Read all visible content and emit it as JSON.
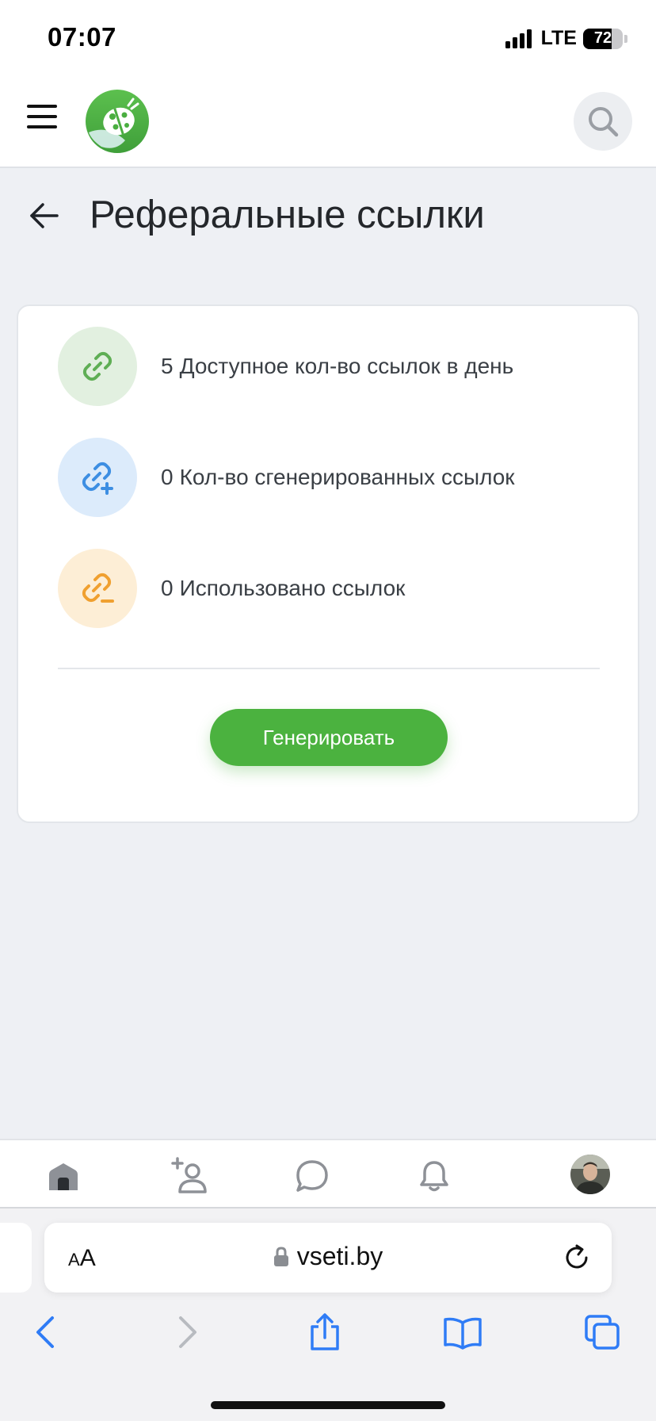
{
  "status_bar": {
    "time": "07:07",
    "network": "LTE",
    "battery": "72",
    "battery_level": 0.72
  },
  "header": {
    "menu_icon": "hamburger-menu-icon",
    "logo_icon": "ladybug-logo-icon",
    "search_icon": "search-icon"
  },
  "page": {
    "title": "Реферальные ссылки",
    "back_icon": "arrow-left-icon"
  },
  "stats": [
    {
      "value": "5",
      "label": "Доступное кол-во ссылок в день",
      "icon": "link-icon",
      "bg": "#e2f0e0",
      "color": "#5fae55"
    },
    {
      "value": "0",
      "label": "Кол-во сгенерированных ссылок",
      "icon": "link-plus-icon",
      "bg": "#dcebfb",
      "color": "#3d8ee2"
    },
    {
      "value": "0",
      "label": "Использовано ссылок",
      "icon": "link-minus-icon",
      "bg": "#fdeed6",
      "color": "#f0a030"
    }
  ],
  "actions": {
    "generate_label": "Генерировать",
    "generate_color": "#4bb23f"
  },
  "bottom_nav": {
    "items": [
      "home-icon",
      "add-friend-icon",
      "chat-icon",
      "bell-icon",
      "avatar"
    ]
  },
  "browser": {
    "text_size_label_small": "A",
    "text_size_label_big": "A",
    "url": "vseti.by",
    "toolbar": [
      "back-icon",
      "forward-icon",
      "share-icon",
      "bookmarks-icon",
      "tabs-icon"
    ]
  }
}
